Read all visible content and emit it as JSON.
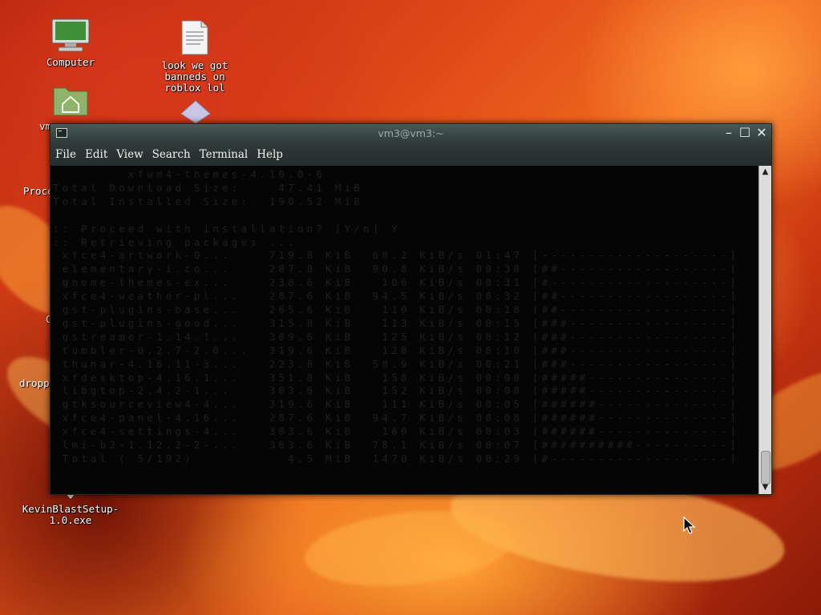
{
  "desktop": {
    "icons": [
      {
        "name": "computer",
        "label": "Computer"
      },
      {
        "name": "file",
        "label": "look we got banneds on roblox lol"
      },
      {
        "name": "home",
        "label": "vm"
      },
      {
        "name": "setup",
        "label": "KevinBlastSetup-1.0.exe"
      }
    ],
    "partial_labels": [
      "Proce",
      "C",
      "dropp"
    ]
  },
  "window": {
    "title": "vm3@vm3:~",
    "menu": [
      "File",
      "Edit",
      "View",
      "Search",
      "Terminal",
      "Help"
    ]
  },
  "terminal": {
    "lines": [
      "        xfwm4-themes-4.10.0-6",
      "Total Download Size:    47.41 MiB",
      "Total Installed Size:  190.52 MiB",
      "",
      ":: Proceed with installation? [Y/n] Y",
      ":: Retrieving packages ...",
      " xfce4-artwork-0...    719.8 KiB  68.2 KiB/s 01:47 [--------------------]   3%",
      " elementary-i.co...    287.8 KiB  90.8 KiB/s 00:38 [##------------------]  10%",
      " gnome-themes-ex...    238.6 KiB   106 KiB/s 00:31 [#-------------------]   9%",
      " xfce4-weather-pl...   287.6 KiB  94.5 KiB/s 00:32 [##------------------]  11%",
      " gst-plugins-base...   265.6 KiB   110 KiB/s 00:18 [##------------------]  10%",
      " gst-plugins-good...   315.8 KiB   113 KiB/s 00:15 [###-----------------]  15%",
      " gstreamer-1.14.1...   309.6 KiB   125 KiB/s 00:12 [###-----------------]  16%",
      " tumbler-0.2.7-2.0...  319.6 KiB   128 KiB/s 00:10 [###-----------------]  19%",
      " thunar-4.16.11-3...   223.8 KiB  58.9 KiB/s 00:21 [###-----------------]  16%",
      " xfdesktop-4.16.1...   351.8 KiB   158 KiB/s 00:08 [#####---------------]  25%",
      " libgtop-2.4.2-1...    303.6 KiB   152 KiB/s 00:08 [#####---------------]  26%",
      " gtksourceview4-4...   319.6 KiB   111 KiB/s 00:05 [######--------------]  32%",
      " xfce4-panel-4.16...   287.6 KiB  94.7 KiB/s 00:08 [######--------------]  32%",
      " xfce4-settings-4...   303.6 KiB   160 KiB/s 00:03 [######--------------]  32%",
      " lmi-b2-1.12.2-2-...   303.6 KiB  78.1 KiB/s 00:07 [##########----------]  53%",
      " Total ( 5/192)          4.5 MiB  1470 KiB/s 00:29 [#-------------------]   5%"
    ]
  },
  "colors": {
    "titlebar": "#3a4846",
    "terminal_bg": "#050505"
  }
}
